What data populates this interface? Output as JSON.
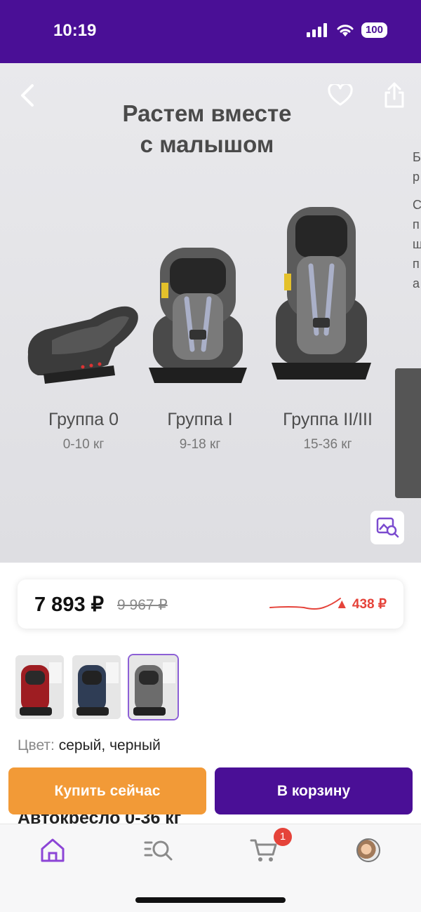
{
  "status_bar": {
    "time": "10:19",
    "battery": "100"
  },
  "hero": {
    "title": "Растем вместе\nс малышом",
    "side_text": [
      "Б",
      "р",
      "",
      "С",
      "п",
      "щ",
      "п",
      "а"
    ],
    "seats": [
      {
        "group": "Группа 0",
        "weight": "0-10 кг"
      },
      {
        "group": "Группа I",
        "weight": "9-18 кг"
      },
      {
        "group": "Группа II/III",
        "weight": "15-36 кг"
      }
    ]
  },
  "price": {
    "current": "7 893 ₽",
    "old": "9 967 ₽",
    "change": "▲ 438 ₽"
  },
  "variant": {
    "color_label": "Цвет:",
    "color_value": "серый, черный"
  },
  "buttons": {
    "buy_now": "Купить сейчас",
    "add_to_cart": "В корзину"
  },
  "product": {
    "title": "Автокресло 0-36 кг"
  },
  "tabbar": {
    "cart_badge": "1"
  },
  "colors": {
    "brand": "#4a0f96",
    "accent": "#f29a37",
    "price_up": "#e5433a"
  },
  "icons": [
    "back-arrow-icon",
    "heart-icon",
    "share-icon",
    "image-search-icon",
    "home-icon",
    "catalog-search-icon",
    "cart-icon",
    "profile-avatar"
  ]
}
